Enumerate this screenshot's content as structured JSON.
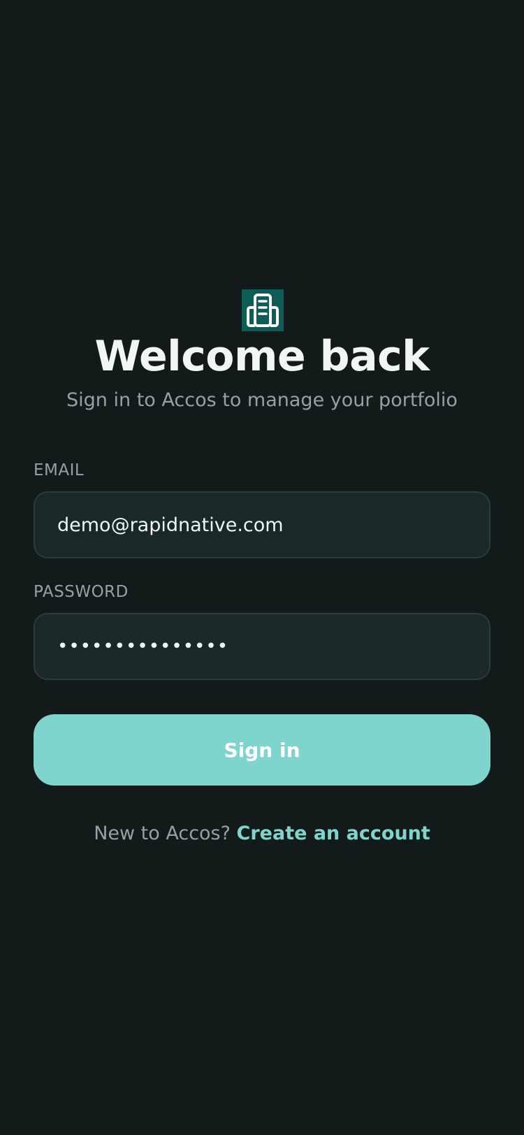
{
  "logo": {
    "icon": "building-icon",
    "bg_color": "#0f5b55"
  },
  "header": {
    "title": "Welcome back",
    "subtitle": "Sign in to Accos to manage your portfolio"
  },
  "form": {
    "email_label": "EMAIL",
    "email_value": "demo@rapidnative.com",
    "password_label": "PASSWORD",
    "password_value": "•••••••••••••••",
    "submit_label": "Sign in"
  },
  "footer": {
    "prompt": "New to Accos?",
    "link_label": "Create an account"
  },
  "colors": {
    "background": "#121a1a",
    "accent": "#7fd5cd",
    "muted_text": "#93a3a3",
    "input_bg": "#1b2829"
  }
}
